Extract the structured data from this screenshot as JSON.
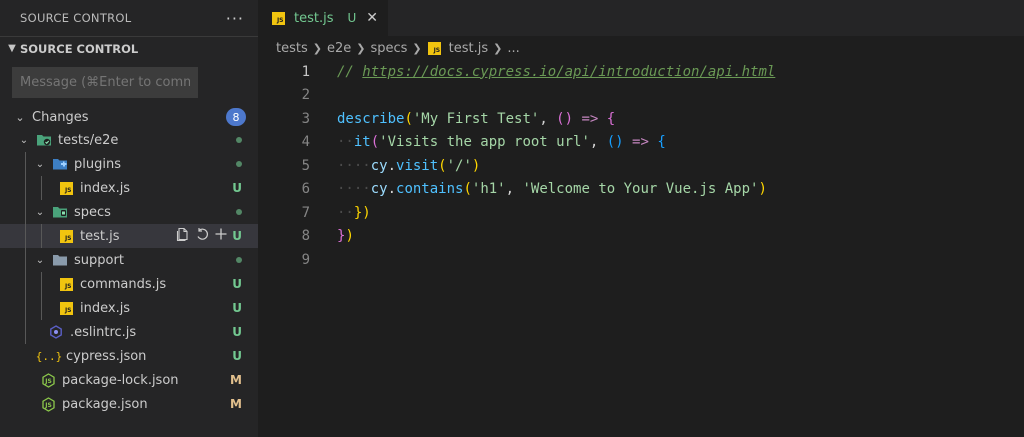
{
  "sidebar": {
    "header_title": "SOURCE CONTROL",
    "more_icon": "ellipsis-icon",
    "section_title": "SOURCE CONTROL",
    "commit_placeholder": "Message (⌘Enter to commit on...",
    "changes_label": "Changes",
    "changes_count": "8",
    "tree": [
      {
        "label": "tests/e2e",
        "type": "folder",
        "status": "dot"
      },
      {
        "label": "plugins",
        "type": "folder",
        "status": "dot"
      },
      {
        "label": "index.js",
        "type": "js",
        "status": "U"
      },
      {
        "label": "specs",
        "type": "folder",
        "status": "dot"
      },
      {
        "label": "test.js",
        "type": "js",
        "status": "U"
      },
      {
        "label": "support",
        "type": "folder",
        "status": "dot"
      },
      {
        "label": "commands.js",
        "type": "js",
        "status": "U"
      },
      {
        "label": "index.js",
        "type": "js",
        "status": "U"
      },
      {
        "label": ".eslintrc.js",
        "type": "eslint",
        "status": "U"
      },
      {
        "label": "cypress.json",
        "type": "json",
        "status": "U"
      },
      {
        "label": "package-lock.json",
        "type": "node",
        "status": "M"
      },
      {
        "label": "package.json",
        "type": "node",
        "status": "M"
      }
    ]
  },
  "editor": {
    "tab_label": "test.js",
    "tab_status": "U",
    "breadcrumb": [
      "tests",
      "e2e",
      "specs",
      "test.js",
      "..."
    ],
    "line_numbers": [
      "1",
      "2",
      "3",
      "4",
      "5",
      "6",
      "7",
      "8",
      "9"
    ],
    "code": {
      "l1_comment": "// ",
      "l1_link": "https://docs.cypress.io/api/introduction/api.html",
      "l3_fn": "describe",
      "l3_open": "(",
      "l3_str": "'My First Test'",
      "l3_comma": ", ",
      "l3_parens": "()",
      "l3_arrow": " => ",
      "l3_brace": "{",
      "l4_fn": "it",
      "l4_open": "(",
      "l4_str": "'Visits the app root url'",
      "l4_comma": ", ",
      "l4_parens": "()",
      "l4_arrow": " => ",
      "l4_brace": "{",
      "l5_obj": "cy",
      "l5_dot": ".",
      "l5_fn": "visit",
      "l5_open": "(",
      "l5_str": "'/'",
      "l5_close": ")",
      "l6_obj": "cy",
      "l6_dot": ".",
      "l6_fn": "contains",
      "l6_open": "(",
      "l6_str1": "'h1'",
      "l6_comma": ", ",
      "l6_str2": "'Welcome to Your Vue.js App'",
      "l6_close": ")",
      "l7_close": "})",
      "l8_close1": "}",
      "l8_close2": ")"
    }
  },
  "colors": {
    "accent_badge": "#4d78cc",
    "untracked": "#73c991",
    "modified": "#e2c08d"
  }
}
